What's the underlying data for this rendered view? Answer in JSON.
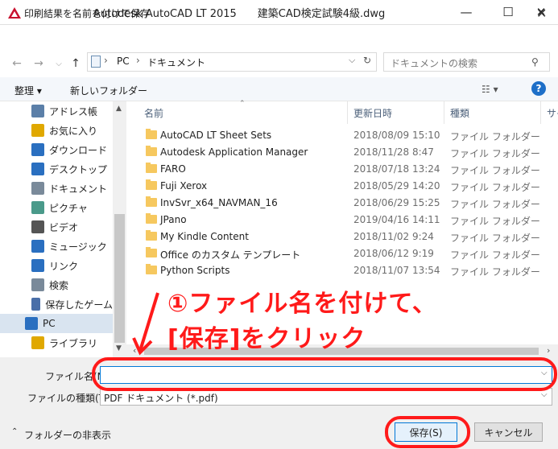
{
  "app_window": {
    "title": "Autodesk AutoCAD LT 2015　　建築CAD検定試験4級.dwg",
    "minimize": "—",
    "maximize": "☐",
    "close": "✕"
  },
  "dialog": {
    "title": "印刷結果を名前を付けて保存",
    "close": "✕"
  },
  "address_bar": {
    "segments": [
      "PC",
      "ドキュメント"
    ],
    "search_placeholder": "ドキュメントの検索"
  },
  "toolbar": {
    "organize": "整理 ▾",
    "new_folder": "新しいフォルダー",
    "help": "?"
  },
  "nav_pane": {
    "items": [
      {
        "label": "アドレス帳",
        "icon": "address-book-icon"
      },
      {
        "label": "お気に入り",
        "icon": "star-icon"
      },
      {
        "label": "ダウンロード",
        "icon": "download-icon"
      },
      {
        "label": "デスクトップ",
        "icon": "desktop-icon"
      },
      {
        "label": "ドキュメント",
        "icon": "document-icon"
      },
      {
        "label": "ピクチャ",
        "icon": "picture-icon"
      },
      {
        "label": "ビデオ",
        "icon": "video-icon"
      },
      {
        "label": "ミュージック",
        "icon": "music-icon"
      },
      {
        "label": "リンク",
        "icon": "link-icon"
      },
      {
        "label": "検索",
        "icon": "search-icon"
      },
      {
        "label": "保存したゲーム",
        "icon": "game-icon"
      },
      {
        "label": "PC",
        "icon": "pc-icon"
      },
      {
        "label": "ライブラリ",
        "icon": "library-icon"
      }
    ]
  },
  "file_list": {
    "columns": [
      "名前",
      "更新日時",
      "種類",
      "サイ"
    ],
    "rows": [
      {
        "name": "AutoCAD LT Sheet Sets",
        "date": "2018/08/09 15:10",
        "type": "ファイル フォルダー"
      },
      {
        "name": "Autodesk Application Manager",
        "date": "2018/11/28 8:47",
        "type": "ファイル フォルダー"
      },
      {
        "name": "FARO",
        "date": "2018/07/18 13:24",
        "type": "ファイル フォルダー"
      },
      {
        "name": "Fuji Xerox",
        "date": "2018/05/29 14:20",
        "type": "ファイル フォルダー"
      },
      {
        "name": "InvSvr_x64_NAVMAN_16",
        "date": "2018/06/29 15:25",
        "type": "ファイル フォルダー"
      },
      {
        "name": "JPano",
        "date": "2019/04/16 14:11",
        "type": "ファイル フォルダー"
      },
      {
        "name": "My Kindle Content",
        "date": "2018/11/02 9:24",
        "type": "ファイル フォルダー"
      },
      {
        "name": "Office のカスタム テンプレート",
        "date": "2018/06/12 9:19",
        "type": "ファイル フォルダー"
      },
      {
        "name": "Python Scripts",
        "date": "2018/11/07 13:54",
        "type": "ファイル フォルダー"
      }
    ]
  },
  "annotation": {
    "line1": "①ファイル名を付けて、",
    "line2": "[保存]をクリック",
    "color": "#ff1a1a"
  },
  "form": {
    "filename_label": "ファイル名(N):",
    "filename_value": "",
    "filetype_label": "ファイルの種類(T):",
    "filetype_value": "PDF ドキュメント (*.pdf)",
    "hide_folders": "フォルダーの非表示",
    "save_button": "保存(S)",
    "cancel_button": "キャンセル"
  }
}
